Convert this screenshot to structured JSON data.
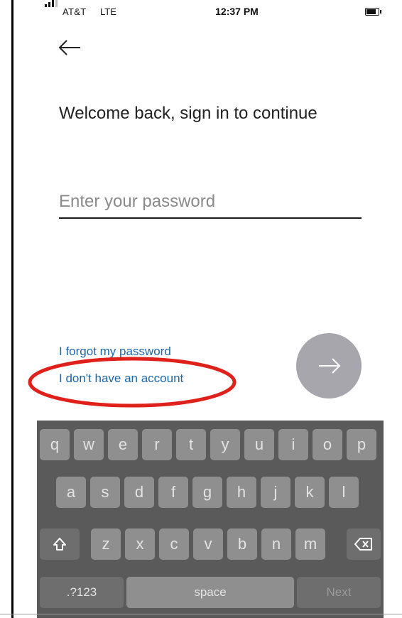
{
  "status_bar": {
    "carrier": "AT&T",
    "network": "LTE",
    "time": "12:37 PM",
    "battery_level": 0.8
  },
  "header": {
    "back_icon": "arrow-left-icon"
  },
  "main": {
    "welcome": "Welcome back, sign in to continue",
    "password_placeholder": "Enter your password",
    "forgot_link": "I forgot my password",
    "no_account_link": "I don't have an account",
    "next_icon": "arrow-right-icon"
  },
  "annotation": {
    "color": "#e0201a"
  },
  "colors": {
    "link": "#1d66a8",
    "next_button": "#a6a6ac",
    "keyboard_bg": "#5a5a5a",
    "key_bg": "#8f8f8f",
    "fn_key_bg": "#6e6e6e"
  },
  "keyboard": {
    "row1": [
      "q",
      "w",
      "e",
      "r",
      "t",
      "y",
      "u",
      "i",
      "o",
      "p"
    ],
    "row2": [
      "a",
      "s",
      "d",
      "f",
      "g",
      "h",
      "j",
      "k",
      "l"
    ],
    "row3": [
      "z",
      "x",
      "c",
      "v",
      "b",
      "n",
      "m"
    ],
    "shift_icon": "shift-icon",
    "delete_icon": "backspace-icon",
    "numbers_label": ".?123",
    "space_label": "space",
    "next_label": "Next"
  }
}
